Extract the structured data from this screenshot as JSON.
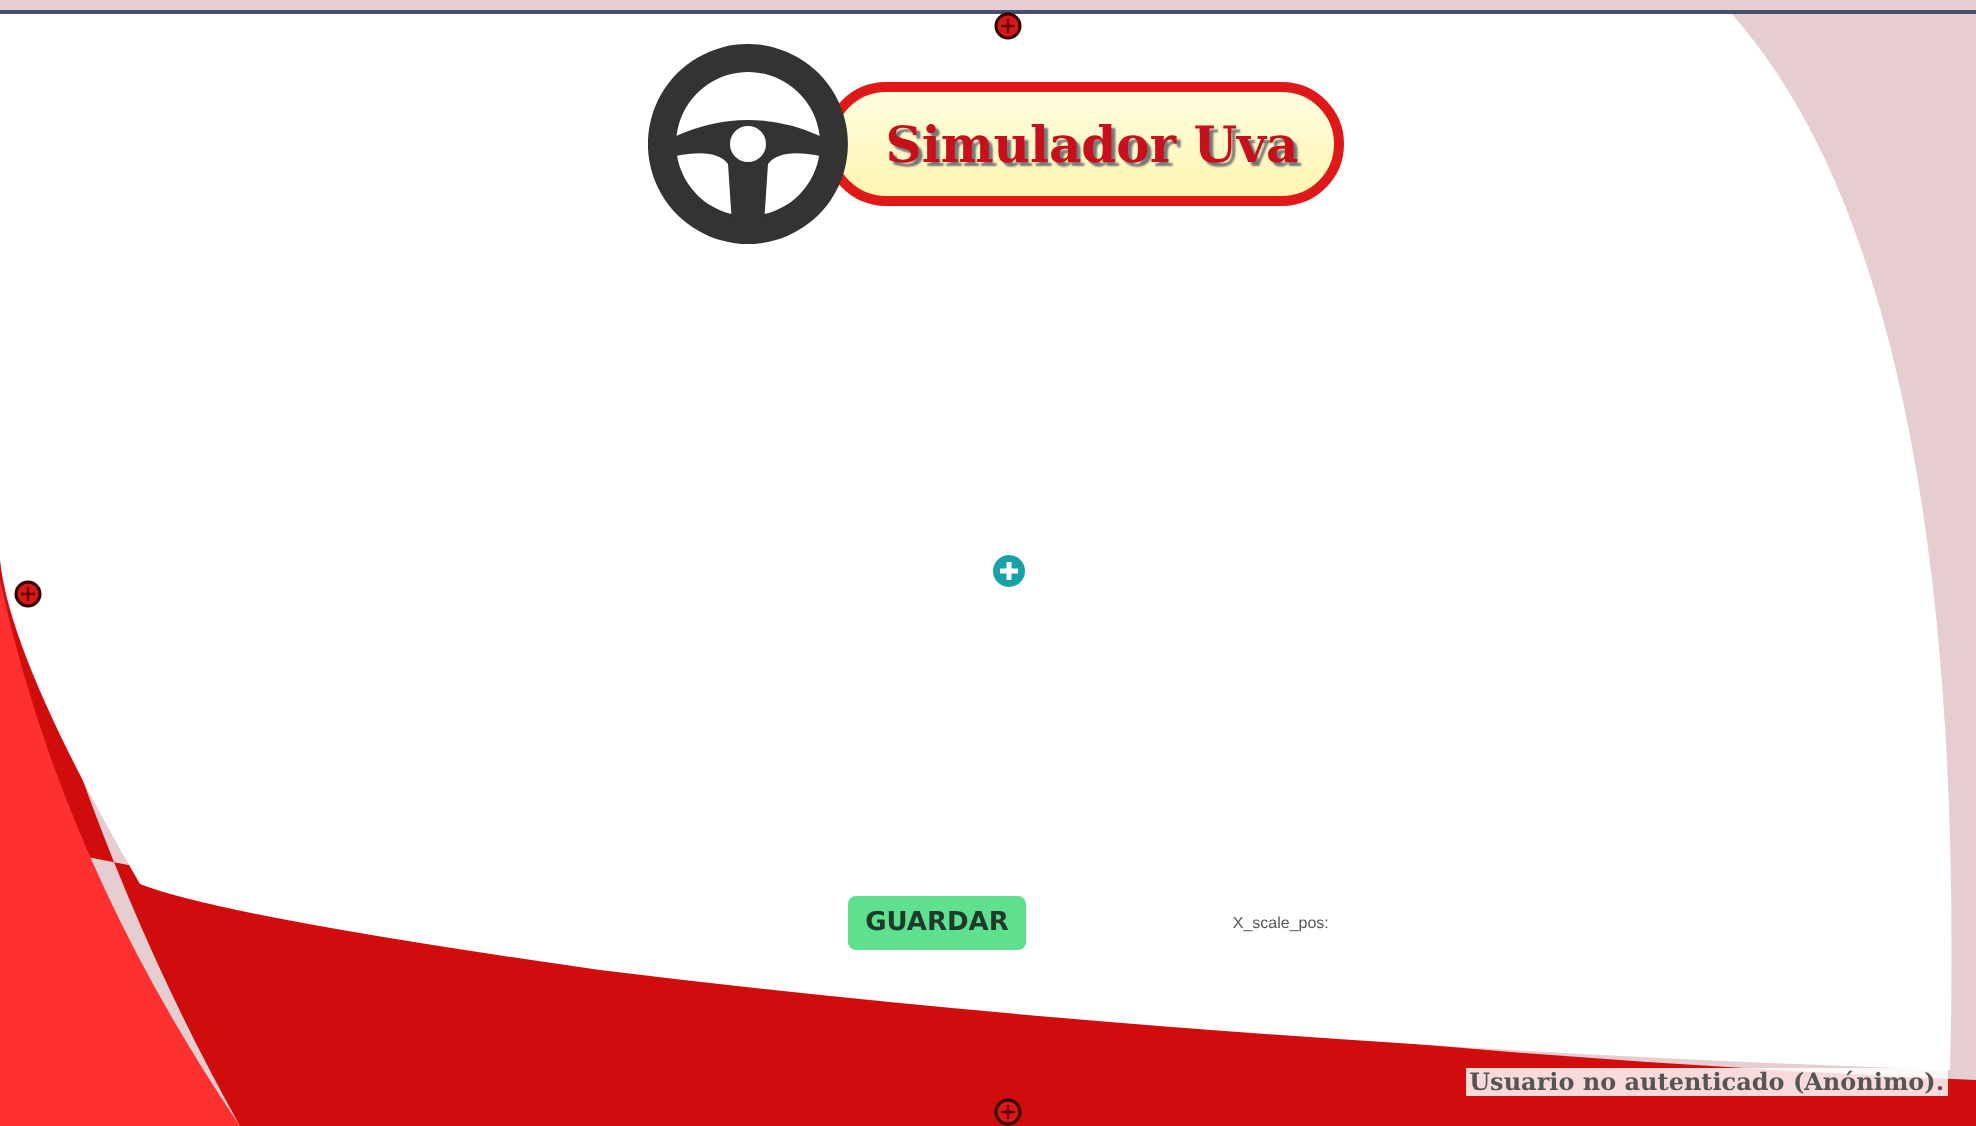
{
  "logo": {
    "title": "Simulador Uva"
  },
  "save_button": {
    "label": "GUARDAR"
  },
  "scale_label": "X_scale_pos:",
  "status": "Usuario no autenticado (Anónimo)."
}
